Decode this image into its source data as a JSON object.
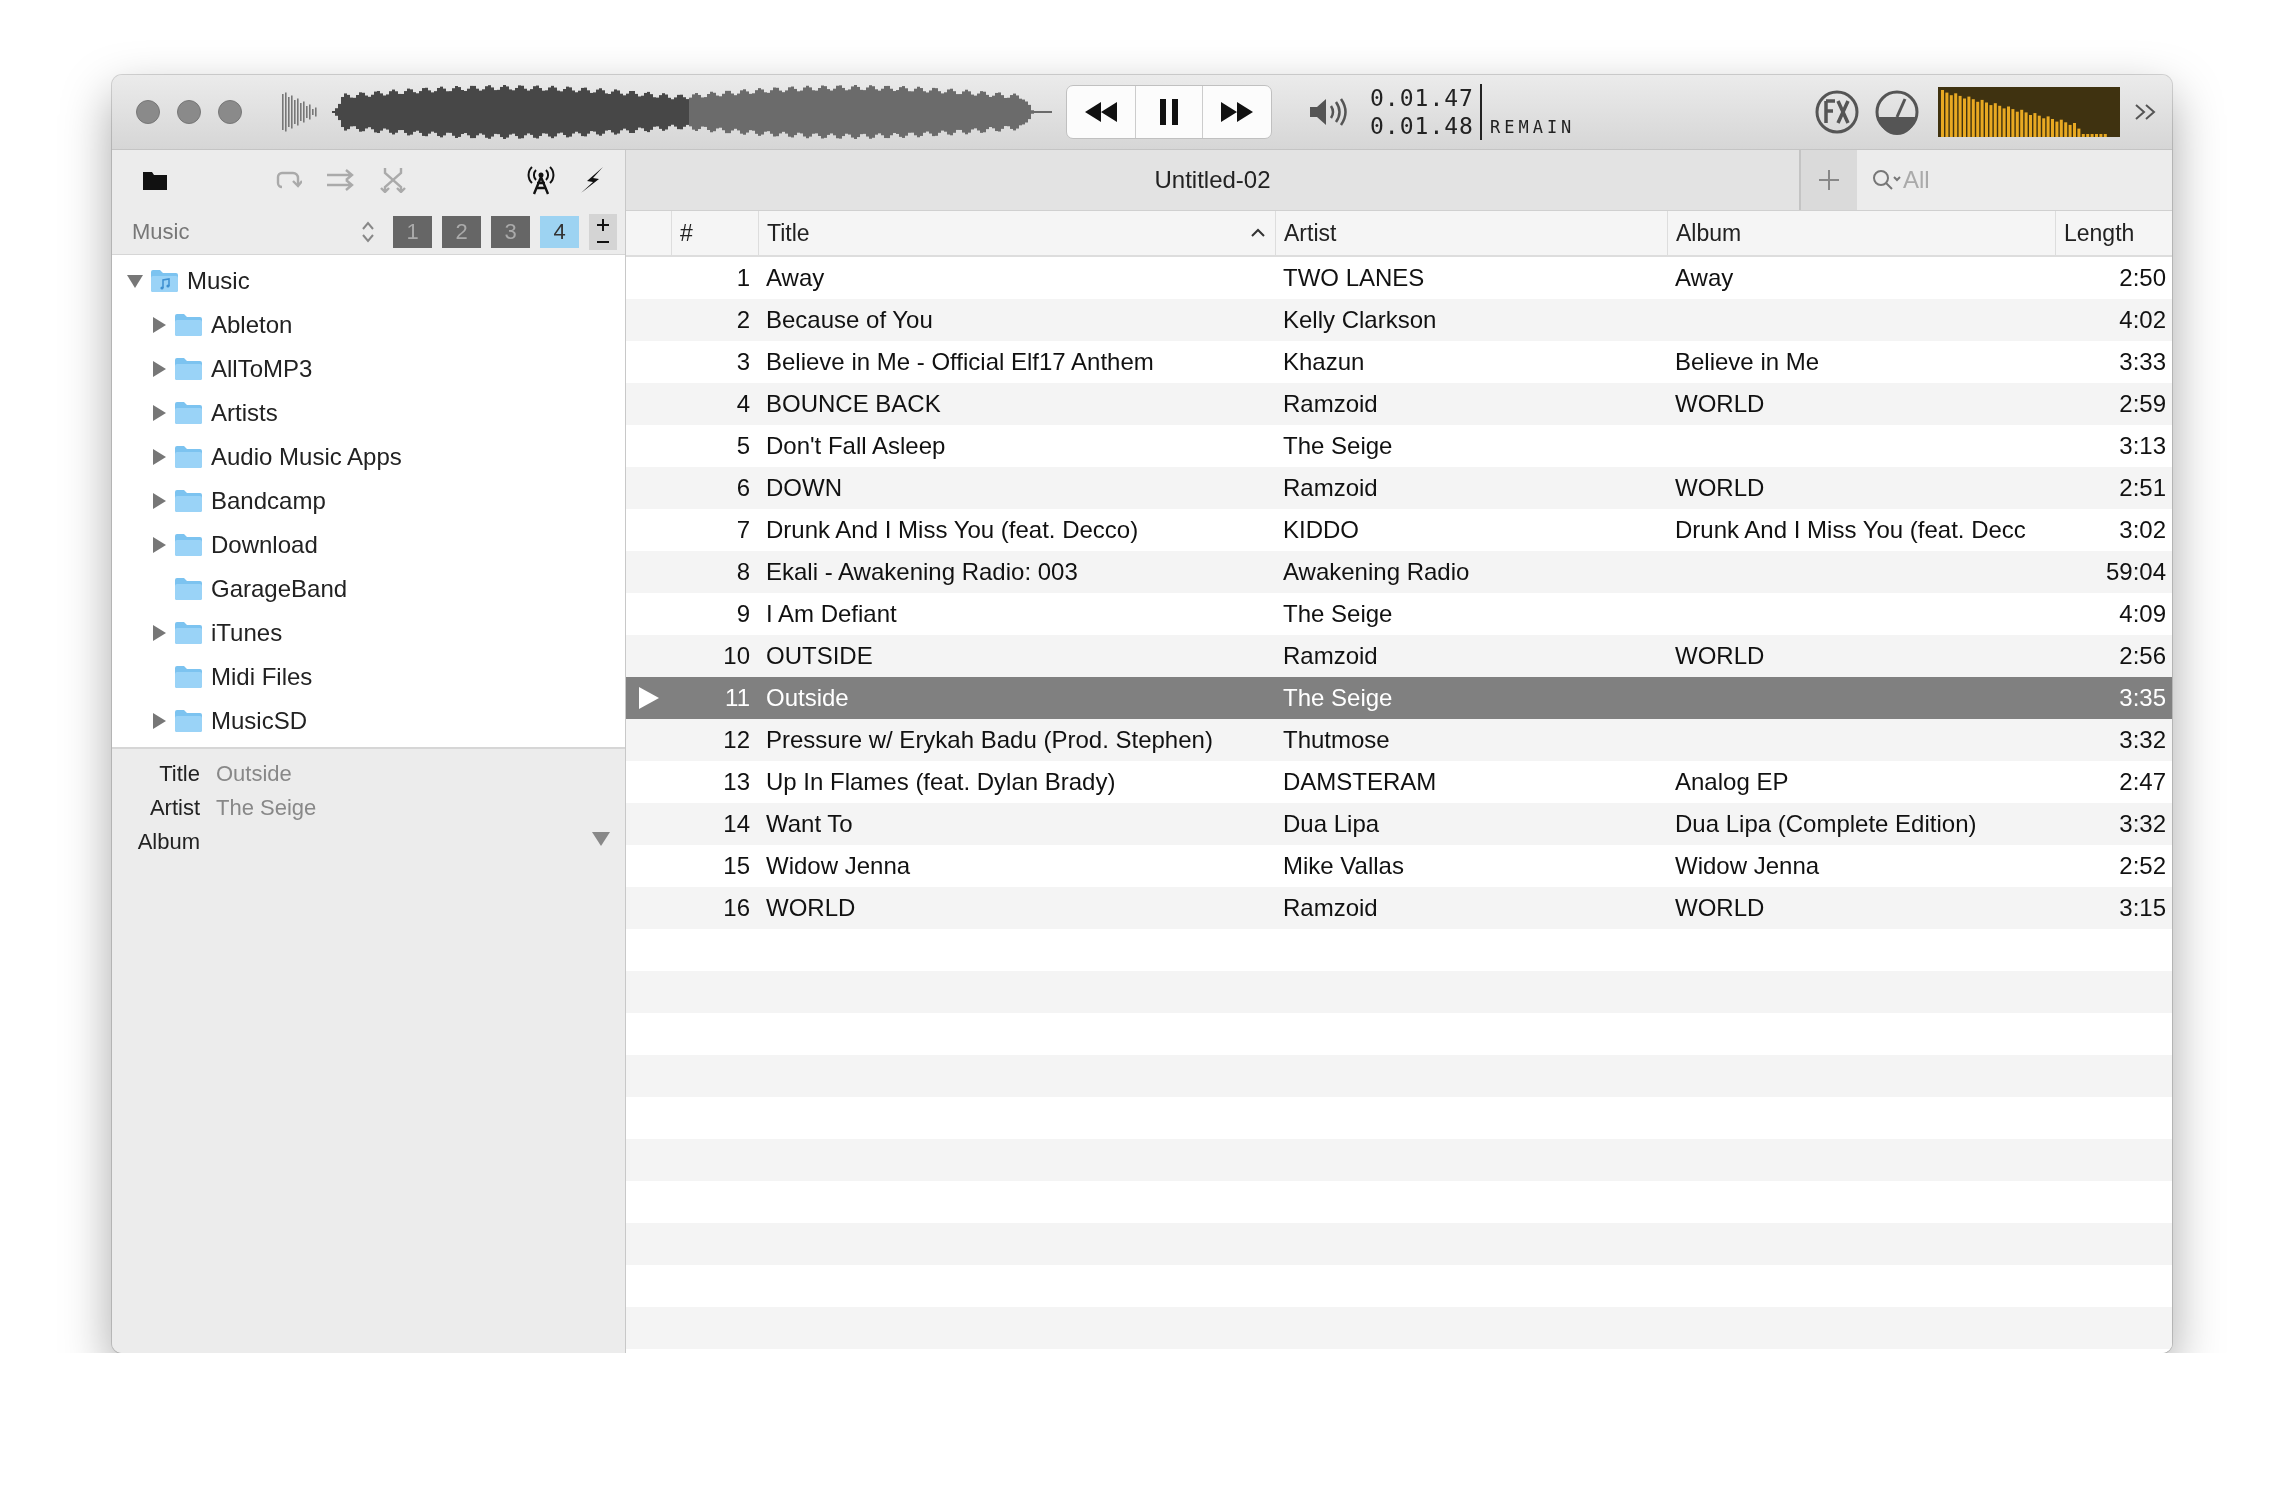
{
  "player": {
    "position": {
      "level": 0.51
    },
    "times": {
      "elapsed": "0.01.47",
      "remaining": "0.01.48",
      "remaining_label": "REMAIN"
    }
  },
  "sidebar": {
    "source": "Music",
    "playlist_tabs": [
      {
        "label": "1",
        "selected": false
      },
      {
        "label": "2",
        "selected": false
      },
      {
        "label": "3",
        "selected": false
      },
      {
        "label": "4",
        "selected": true
      }
    ],
    "tree": [
      {
        "label": "Music",
        "kind": "music-folder",
        "expanded": true,
        "children": [
          {
            "label": "Ableton",
            "kind": "folder",
            "expanded": false
          },
          {
            "label": "AllToMP3",
            "kind": "folder",
            "expanded": false
          },
          {
            "label": "Artists",
            "kind": "folder",
            "expanded": false
          },
          {
            "label": "Audio Music Apps",
            "kind": "folder",
            "expanded": false
          },
          {
            "label": "Bandcamp",
            "kind": "folder",
            "expanded": false
          },
          {
            "label": "Download",
            "kind": "folder",
            "expanded": false
          },
          {
            "label": "GarageBand",
            "kind": "folder"
          },
          {
            "label": "iTunes",
            "kind": "folder",
            "expanded": false
          },
          {
            "label": "Midi Files",
            "kind": "folder"
          },
          {
            "label": "MusicSD",
            "kind": "folder",
            "expanded": false
          }
        ]
      }
    ],
    "info": [
      {
        "label": "Title",
        "value": "Outside"
      },
      {
        "label": "Artist",
        "value": "The Seige"
      },
      {
        "label": "Album"
      }
    ]
  },
  "playlist": {
    "title": "Untitled-02",
    "search": {
      "placeholder": "All"
    },
    "columns": [
      {
        "label": "#",
        "sorted": false
      },
      {
        "label": "Title",
        "sorted": true
      },
      {
        "label": "Artist",
        "sorted": false
      },
      {
        "label": "Album",
        "sorted": false
      },
      {
        "label": "Length",
        "sorted": false
      }
    ],
    "rows": [
      {
        "n": "1",
        "title": "Away",
        "artist": "TWO LANES",
        "album": "Away",
        "length": "2:50",
        "selected": false,
        "playing": false
      },
      {
        "n": "2",
        "title": "Because of You",
        "artist": "Kelly Clarkson",
        "length": "4:02",
        "selected": false,
        "playing": false
      },
      {
        "n": "3",
        "title": "Believe in Me - Official Elf17 Anthem",
        "artist": "Khazun",
        "album": "Believe in Me",
        "length": "3:33",
        "selected": false,
        "playing": false
      },
      {
        "n": "4",
        "title": "BOUNCE BACK",
        "artist": "Ramzoid",
        "album": "WORLD",
        "length": "2:59",
        "selected": false,
        "playing": false
      },
      {
        "n": "5",
        "title": "Don't Fall Asleep",
        "artist": "The Seige",
        "length": "3:13",
        "selected": false,
        "playing": false
      },
      {
        "n": "6",
        "title": "DOWN",
        "artist": "Ramzoid",
        "album": "WORLD",
        "length": "2:51",
        "selected": false,
        "playing": false
      },
      {
        "n": "7",
        "title": "Drunk And I Miss You (feat. Decco)",
        "artist": "KIDDO",
        "album": "Drunk And I Miss You (feat. Decc",
        "length": "3:02",
        "selected": false,
        "playing": false
      },
      {
        "n": "8",
        "title": "Ekali - Awakening Radio: 003",
        "artist": "Awakening Radio",
        "length": "59:04",
        "selected": false,
        "playing": false
      },
      {
        "n": "9",
        "title": "I Am Defiant",
        "artist": "The Seige",
        "length": "4:09",
        "selected": false,
        "playing": false
      },
      {
        "n": "10",
        "title": "OUTSIDE",
        "artist": "Ramzoid",
        "album": "WORLD",
        "length": "2:56",
        "selected": false,
        "playing": false
      },
      {
        "n": "11",
        "title": "Outside",
        "artist": "The Seige",
        "length": "3:35",
        "selected": true,
        "playing": true
      },
      {
        "n": "12",
        "title": "Pressure w/ Erykah Badu (Prod. Stephen)",
        "artist": "Thutmose",
        "length": "3:32",
        "selected": false,
        "playing": false
      },
      {
        "n": "13",
        "title": "Up In Flames (feat. Dylan Brady)",
        "artist": "DAMSTERAM",
        "album": "Analog EP",
        "length": "2:47",
        "selected": false,
        "playing": false
      },
      {
        "n": "14",
        "title": "Want To",
        "artist": "Dua Lipa",
        "album": "Dua Lipa (Complete Edition)",
        "length": "3:32",
        "selected": false,
        "playing": false
      },
      {
        "n": "15",
        "title": "Widow Jenna",
        "artist": "Mike Vallas",
        "album": "Widow Jenna",
        "length": "2:52",
        "selected": false,
        "playing": false
      },
      {
        "n": "16",
        "title": "WORLD",
        "artist": "Ramzoid",
        "album": "WORLD",
        "length": "3:15",
        "selected": false,
        "playing": false
      }
    ]
  }
}
